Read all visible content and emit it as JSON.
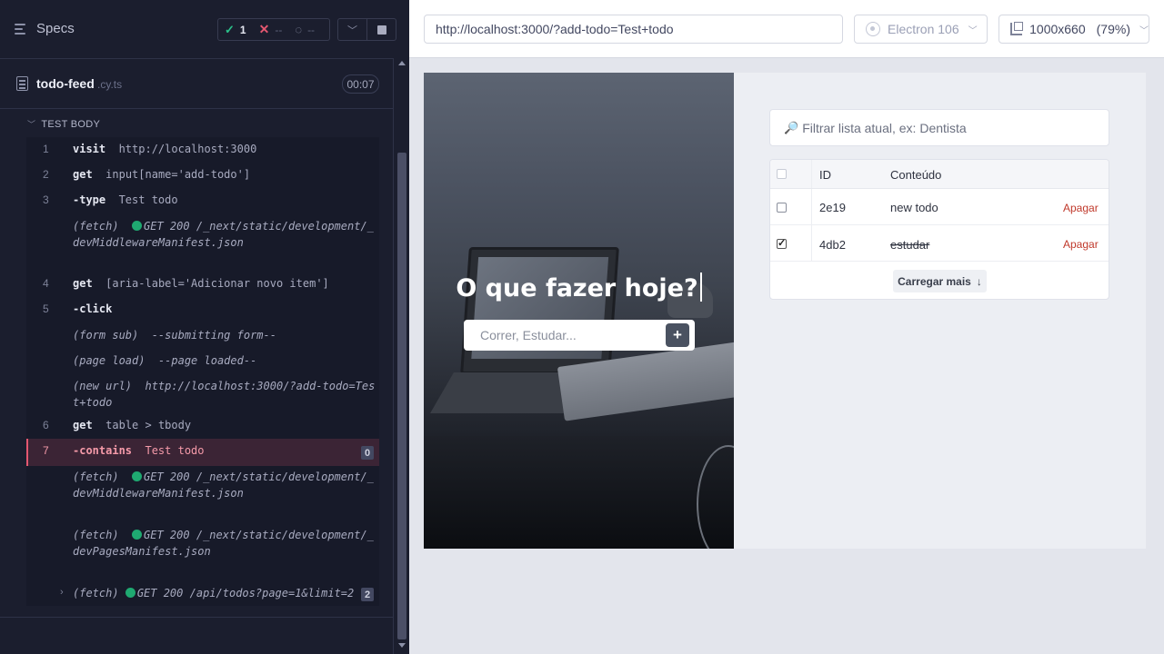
{
  "reporter": {
    "specs_label": "Specs",
    "stats": {
      "passed": "1",
      "failed": "--",
      "pending": "--"
    },
    "spec": {
      "name": "todo-feed",
      "ext": ".cy.ts",
      "duration": "00:07"
    },
    "test_title": "TEST BODY",
    "commands": [
      {
        "num": "1",
        "name": "visit",
        "message": "http://localhost:3000"
      },
      {
        "num": "2",
        "name": "get",
        "message": "input[name='add-todo']"
      },
      {
        "num": "3",
        "name": "-type",
        "message": "Test todo"
      },
      {
        "event": "(fetch)",
        "status": "GET 200",
        "url": "/_next/static/development/_devMiddlewareManifest.json"
      },
      {
        "num": "4",
        "name": "get",
        "message": "[aria-label='Adicionar novo item']"
      },
      {
        "num": "5",
        "name": "-click",
        "message": ""
      },
      {
        "event": "(form sub)",
        "text": "--submitting form--"
      },
      {
        "event": "(page load)",
        "text": "--page loaded--"
      },
      {
        "event": "(new url)",
        "text": "http://localhost:3000/?add-todo=Test+todo"
      },
      {
        "num": "6",
        "name": "get",
        "message": "table > tbody"
      },
      {
        "num": "7",
        "name": "-contains",
        "message": "Test todo",
        "badge": "0"
      },
      {
        "event": "(fetch)",
        "status": "GET 200",
        "url": "/_next/static/development/_devMiddlewareManifest.json"
      },
      {
        "event": "(fetch)",
        "status": "GET 200",
        "url": "/_next/static/development/_devPagesManifest.json"
      },
      {
        "event": "(fetch)",
        "status": "GET 200",
        "url": "/api/todos?page=1&limit=2",
        "badge": "2"
      }
    ]
  },
  "runner": {
    "url": "http://localhost:3000/?add-todo=Test+todo",
    "browser": "Electron 106",
    "viewport": "1000x660",
    "zoom": "(79%)"
  },
  "app": {
    "hero_title": "O que fazer hoje?",
    "todo_placeholder": "Correr, Estudar...",
    "add_button": "+",
    "filter_placeholder": "Filtrar  lista atual, ex: Dentista",
    "table": {
      "headers": [
        "ID",
        "Conteúdo"
      ],
      "rows": [
        {
          "id": "2e19",
          "content": "new todo",
          "done": false,
          "action": "Apagar"
        },
        {
          "id": "4db2",
          "content": "estudar",
          "done": true,
          "action": "Apagar"
        }
      ],
      "load_more": "Carregar mais",
      "load_more_arrow": "↓"
    }
  },
  "colors": {
    "reporter_bg": "#1b1e2e",
    "pass": "#2bc08a",
    "fail": "#e45770",
    "delete_link": "#c0392b"
  }
}
